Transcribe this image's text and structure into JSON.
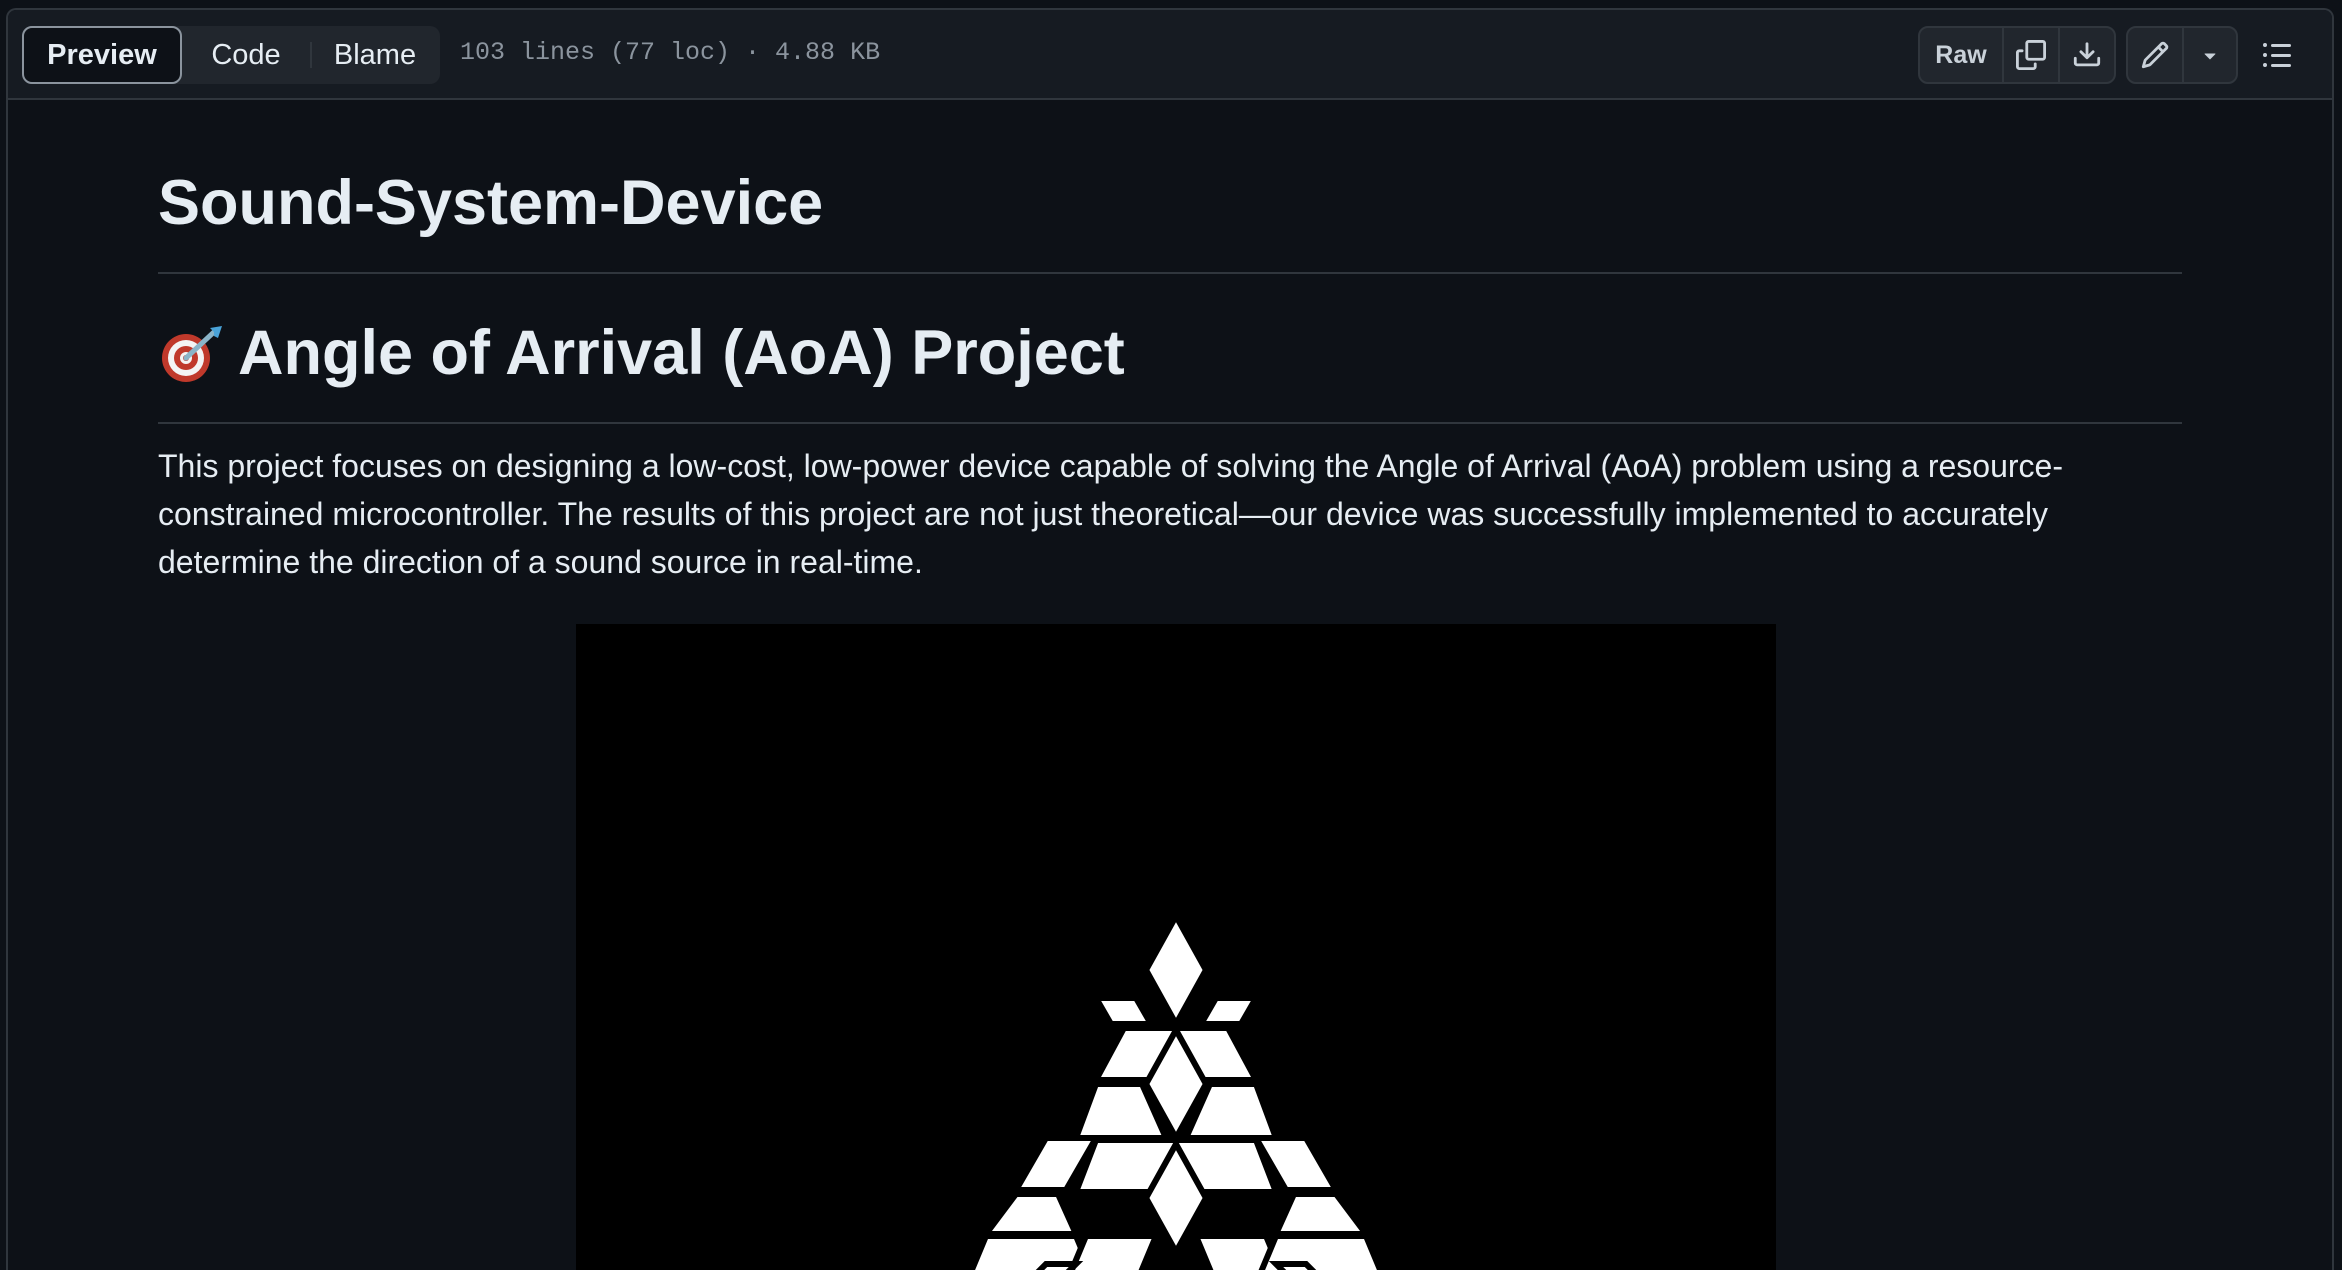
{
  "toolbar": {
    "tabs": [
      {
        "label": "Preview",
        "active": true
      },
      {
        "label": "Code",
        "active": false
      },
      {
        "label": "Blame",
        "active": false
      }
    ],
    "file_info": "103 lines (77 loc) · 4.88 KB",
    "raw_label": "Raw",
    "icons": [
      "copy-icon",
      "download-icon",
      "pencil-icon",
      "triangle-down-icon",
      "list-unordered-icon"
    ]
  },
  "article": {
    "title": "Sound-System-Device",
    "heading_emoji": "direct-hit-target-icon",
    "heading": "Angle of Arrival (AoA) Project",
    "paragraph": "This project focuses on designing a low-cost, low-power device capable of solving the Angle of Arrival (AoA) problem using a resource-constrained microcontroller. The results of this project are not just theoretical—our device was successfully implemented to accurately determine the direction of a sound source in real-time.",
    "image": "triangle-logo-image"
  },
  "colors": {
    "page_bg": "#0d1117",
    "toolbar_bg": "#161b22",
    "border": "#30363d",
    "text": "#e6edf3",
    "muted": "#8b949e"
  }
}
